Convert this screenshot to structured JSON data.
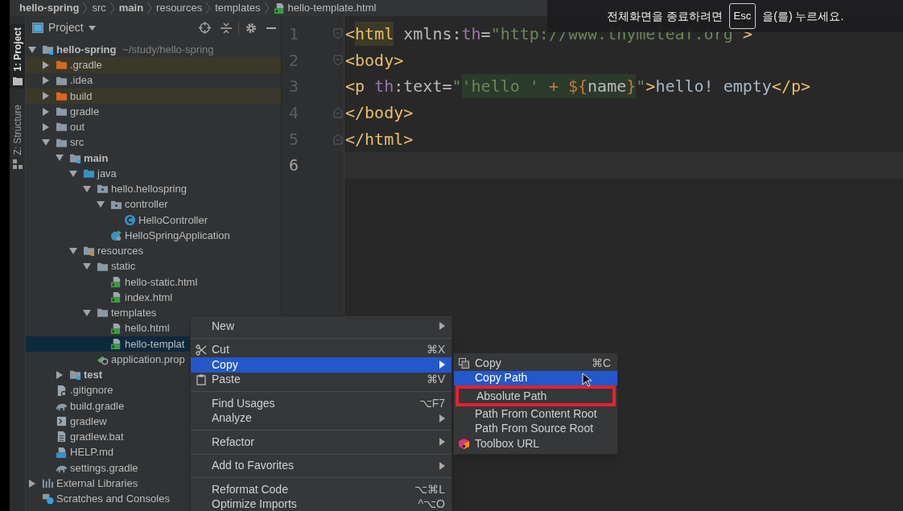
{
  "breadcrumbs": [
    {
      "label": "hello-spring",
      "kind": "module"
    },
    {
      "label": "src",
      "kind": "folder"
    },
    {
      "label": "main",
      "kind": "module"
    },
    {
      "label": "resources",
      "kind": "folder"
    },
    {
      "label": "templates",
      "kind": "folder"
    },
    {
      "label": "hello-template.html",
      "kind": "html"
    }
  ],
  "tool_tabs": [
    {
      "label": "1: Project",
      "kind": "project",
      "selected": true
    },
    {
      "label": "Z: Structure",
      "kind": "structure",
      "selected": false
    }
  ],
  "project_panel": {
    "title": "Project"
  },
  "project_tree": [
    {
      "label": "hello-spring",
      "hint": "~/study/hello-spring",
      "kind": "module",
      "expanded": true,
      "selected": false,
      "children": [
        {
          "label": ".gradle",
          "kind": "folder-excluded",
          "expanded": false,
          "selected": false
        },
        {
          "label": ".idea",
          "kind": "folder",
          "expanded": false,
          "selected": false
        },
        {
          "label": "build",
          "kind": "folder-excluded",
          "expanded": false,
          "selected": false
        },
        {
          "label": "gradle",
          "kind": "folder",
          "expanded": false,
          "selected": false
        },
        {
          "label": "out",
          "kind": "folder",
          "expanded": false,
          "selected": false
        },
        {
          "label": "src",
          "kind": "folder",
          "expanded": true,
          "selected": false,
          "children": [
            {
              "label": "main",
              "kind": "module",
              "expanded": true,
              "selected": false,
              "children": [
                {
                  "label": "java",
                  "kind": "source",
                  "expanded": true,
                  "selected": false,
                  "children": [
                    {
                      "label": "hello.hellospring",
                      "kind": "package",
                      "expanded": true,
                      "selected": false,
                      "children": [
                        {
                          "label": "controller",
                          "kind": "package",
                          "expanded": true,
                          "selected": false,
                          "children": [
                            {
                              "label": "HelloController",
                              "kind": "class",
                              "selected": false
                            }
                          ]
                        },
                        {
                          "label": "HelloSpringApplication",
                          "kind": "spring-app",
                          "selected": false
                        }
                      ]
                    }
                  ]
                },
                {
                  "label": "resources",
                  "kind": "resources",
                  "expanded": true,
                  "selected": false,
                  "children": [
                    {
                      "label": "static",
                      "kind": "folder",
                      "expanded": true,
                      "selected": false,
                      "children": [
                        {
                          "label": "hello-static.html",
                          "kind": "html",
                          "selected": false
                        },
                        {
                          "label": "index.html",
                          "kind": "html",
                          "selected": false
                        }
                      ]
                    },
                    {
                      "label": "templates",
                      "kind": "folder",
                      "expanded": true,
                      "selected": false,
                      "children": [
                        {
                          "label": "hello.html",
                          "kind": "html",
                          "selected": false
                        },
                        {
                          "label": "hello-templat",
                          "kind": "html",
                          "selected": true
                        }
                      ]
                    },
                    {
                      "label": "application.prop",
                      "kind": "properties",
                      "selected": false
                    }
                  ]
                }
              ]
            },
            {
              "label": "test",
              "kind": "module",
              "expanded": false,
              "selected": false
            }
          ]
        },
        {
          "label": ".gitignore",
          "kind": "ignore",
          "selected": false
        },
        {
          "label": "build.gradle",
          "kind": "gradle",
          "selected": false
        },
        {
          "label": "gradlew",
          "kind": "script",
          "selected": false
        },
        {
          "label": "gradlew.bat",
          "kind": "text",
          "selected": false
        },
        {
          "label": "HELP.md",
          "kind": "markdown",
          "selected": false
        },
        {
          "label": "settings.gradle",
          "kind": "gradle",
          "selected": false
        }
      ]
    },
    {
      "label": "External Libraries",
      "kind": "libraries",
      "expanded": false,
      "selected": false
    },
    {
      "label": "Scratches and Consoles",
      "kind": "scratches",
      "selected": false
    }
  ],
  "editor": {
    "lines": [
      {
        "number": "1",
        "current": false,
        "kind": "fold-start",
        "tokens": [
          {
            "text": "<",
            "kind": "tag"
          },
          {
            "text": "html",
            "kind": "tag-match"
          },
          {
            "text": " xmlns:",
            "kind": "attr"
          },
          {
            "text": "th",
            "kind": "ns"
          },
          {
            "text": "=",
            "kind": "attr"
          },
          {
            "text": "\"http://www.thymeleaf.org\"",
            "kind": "string"
          },
          {
            "text": ">",
            "kind": "tag"
          }
        ]
      },
      {
        "number": "2",
        "current": false,
        "kind": "fold-start",
        "tokens": [
          {
            "text": "<body>",
            "kind": "tag"
          }
        ]
      },
      {
        "number": "3",
        "current": false,
        "kind": "plain",
        "tokens": [
          {
            "text": "<p ",
            "kind": "tag"
          },
          {
            "text": "th",
            "kind": "ns"
          },
          {
            "text": ":text=",
            "kind": "attr"
          },
          {
            "text": "\"",
            "kind": "string"
          },
          {
            "text": "'hello ' ",
            "kind": "inject-string"
          },
          {
            "text": "+ ${",
            "kind": "inject-op"
          },
          {
            "text": "name",
            "kind": "inject-name"
          },
          {
            "text": "}",
            "kind": "inject-op"
          },
          {
            "text": "\"",
            "kind": "string"
          },
          {
            "text": ">",
            "kind": "tag"
          },
          {
            "text": "hello! empty",
            "kind": "text"
          },
          {
            "text": "</p>",
            "kind": "tag"
          }
        ]
      },
      {
        "number": "4",
        "current": false,
        "kind": "fold-end",
        "tokens": [
          {
            "text": "</body>",
            "kind": "tag"
          }
        ]
      },
      {
        "number": "5",
        "current": false,
        "kind": "fold-end",
        "tokens": [
          {
            "text": "</html>",
            "kind": "tag"
          }
        ]
      },
      {
        "number": "6",
        "current": true,
        "kind": "plain"
      }
    ]
  },
  "fullscreen_notice": {
    "before": "전체화면을 종료하려면",
    "key": "Esc",
    "after": "을(를) 누르세요."
  },
  "context_menu": {
    "groups": [
      [
        {
          "label": "New",
          "submenu": true,
          "selected": false
        }
      ],
      [
        {
          "label": "Cut",
          "kind": "cut",
          "shortcut": "⌘X",
          "submenu": false,
          "selected": false
        },
        {
          "label": "Copy",
          "submenu": true,
          "selected": true
        },
        {
          "label": "Paste",
          "kind": "paste",
          "shortcut": "⌘V",
          "submenu": false,
          "selected": false
        }
      ],
      [
        {
          "label": "Find Usages",
          "shortcut": "⌥F7",
          "submenu": false,
          "selected": false
        },
        {
          "label": "Analyze",
          "submenu": true,
          "selected": false
        }
      ],
      [
        {
          "label": "Refactor",
          "submenu": true,
          "selected": false
        }
      ],
      [
        {
          "label": "Add to Favorites",
          "submenu": true,
          "selected": false
        }
      ],
      [
        {
          "label": "Reformat Code",
          "shortcut": "⌥⌘L",
          "submenu": false,
          "selected": false
        },
        {
          "label": "Optimize Imports",
          "shortcut": "^⌥O",
          "submenu": false,
          "selected": false
        }
      ]
    ]
  },
  "copy_submenu": {
    "items": [
      {
        "label": "Copy",
        "kind": "copy",
        "shortcut": "⌘C",
        "selected": false,
        "boxed": false
      },
      {
        "label": "Copy Path",
        "selected": true,
        "boxed": false
      },
      {
        "label": "Absolute Path",
        "selected": false,
        "boxed": true
      },
      {
        "label": "Path From Content Root",
        "selected": false,
        "boxed": false
      },
      {
        "label": "Path From Source Root",
        "selected": false,
        "boxed": false
      },
      {
        "label": "Toolbox URL",
        "kind": "toolbox",
        "selected": false,
        "boxed": false
      }
    ]
  }
}
